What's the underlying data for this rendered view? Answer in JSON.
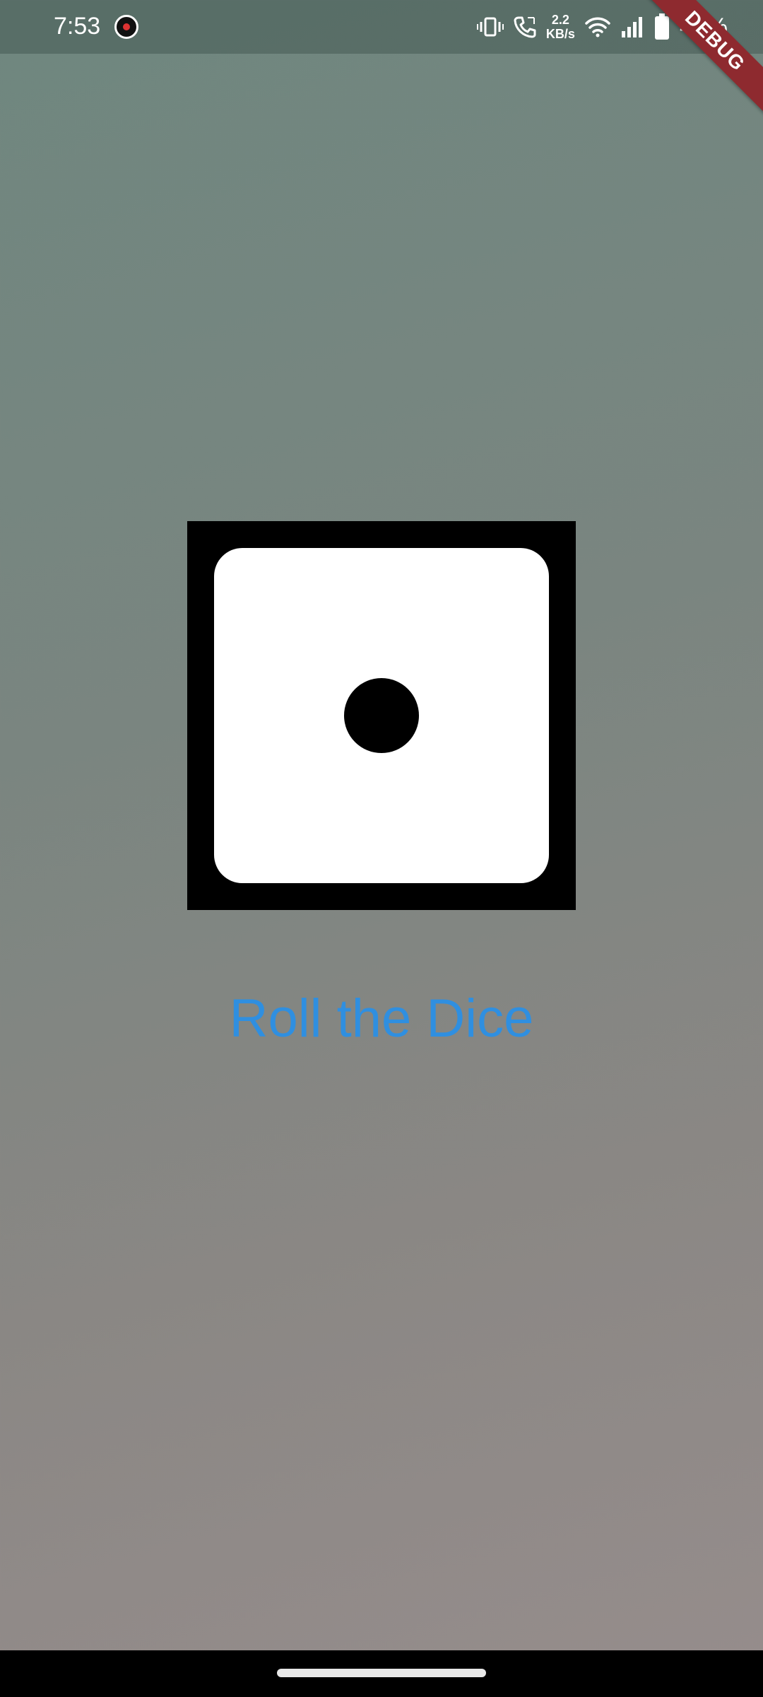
{
  "status_bar": {
    "time": "7:53",
    "net_speed_value": "2.2",
    "net_speed_unit": "KB/s",
    "battery": "49%"
  },
  "debug_banner": {
    "label": "DEBUG"
  },
  "dice": {
    "face_value": 1
  },
  "roll_button": {
    "label": "Roll the Dice"
  },
  "colors": {
    "accent": "#2f8fe0",
    "debug_banner": "#8e2a2f",
    "dice_frame": "#000000",
    "dice_face": "#ffffff"
  },
  "icons": [
    "app-notification-icon",
    "vibrate-icon",
    "call-icon",
    "wifi-icon",
    "signal-icon",
    "battery-icon"
  ]
}
